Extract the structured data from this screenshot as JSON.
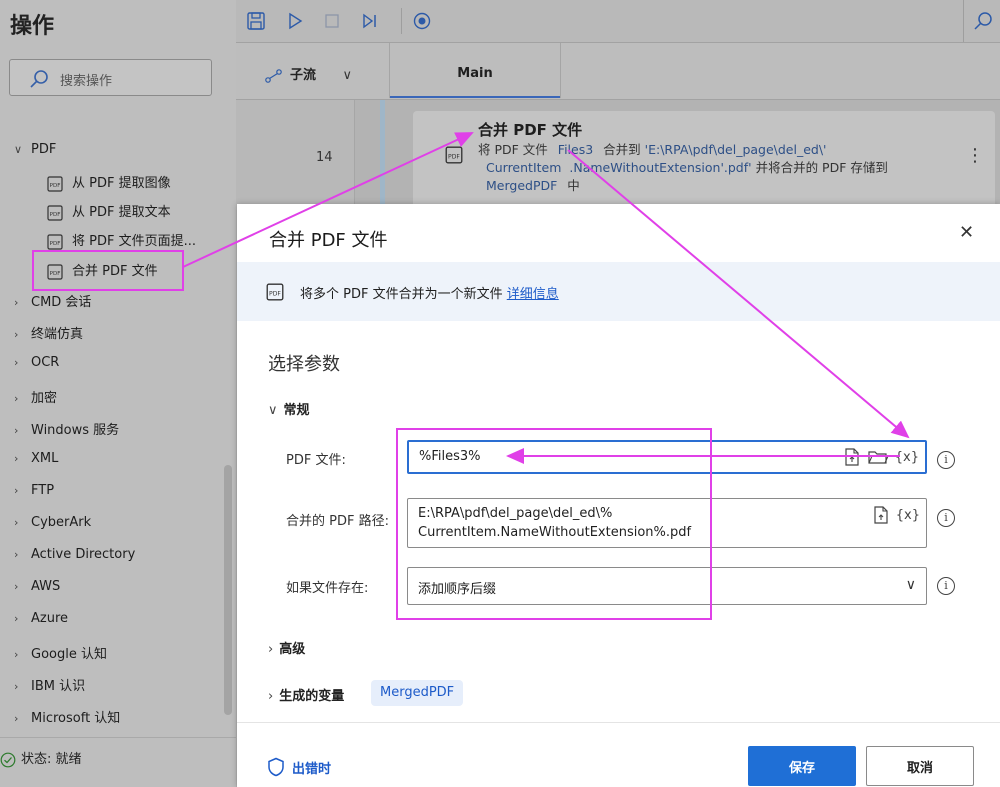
{
  "left_pane": {
    "title": "操作",
    "search_placeholder": "搜索操作",
    "pdf_category": "PDF",
    "pdf_items": [
      "从 PDF 提取图像",
      "从 PDF 提取文本",
      "将 PDF 文件页面提...",
      "合并 PDF 文件"
    ],
    "categories": [
      "CMD 会话",
      "终端仿真",
      "OCR",
      "加密",
      "Windows 服务",
      "XML",
      "FTP",
      "CyberArk",
      "Active Directory",
      "AWS",
      "Azure",
      "Google 认知",
      "IBM 认识",
      "Microsoft 认知"
    ],
    "status": "状态: 就绪"
  },
  "designer": {
    "subflow_tab": "子流",
    "main_tab": "Main",
    "line_number": "14",
    "step_title": "合并 PDF 文件",
    "step_desc": {
      "prefix": "将 PDF 文件",
      "var1": "Files3",
      "mid1": "合并到",
      "path1": "'E:\\RPA\\pdf\\del_page\\del_ed\\'",
      "var2": "CurrentItem",
      "path2": ".NameWithoutExtension'.pdf'",
      "mid2": "并将合并的 PDF 存储到",
      "var3": "MergedPDF",
      "suffix": "中"
    }
  },
  "dialog": {
    "title": "合并 PDF 文件",
    "banner_text": "将多个 PDF 文件合并为一个新文件",
    "banner_link": "详细信息",
    "section_title": "选择参数",
    "group_general": "常规",
    "fields": {
      "pdf_files_label": "PDF 文件:",
      "pdf_files_value": "%Files3%",
      "merged_path_label": "合并的 PDF 路径:",
      "merged_path_line1": "E:\\RPA\\pdf\\del_page\\del_ed\\%",
      "merged_path_line2": "CurrentItem.NameWithoutExtension%.pdf",
      "if_exists_label": "如果文件存在:",
      "if_exists_value": "添加顺序后缀",
      "var_picker": "{x}"
    },
    "group_advanced": "高级",
    "group_variables": "生成的变量",
    "variable_chip": "MergedPDF",
    "on_error": "出错时",
    "save": "保存",
    "cancel": "取消"
  },
  "colors": {
    "accent": "#1f6fd6",
    "annotation": "#e040e8"
  }
}
